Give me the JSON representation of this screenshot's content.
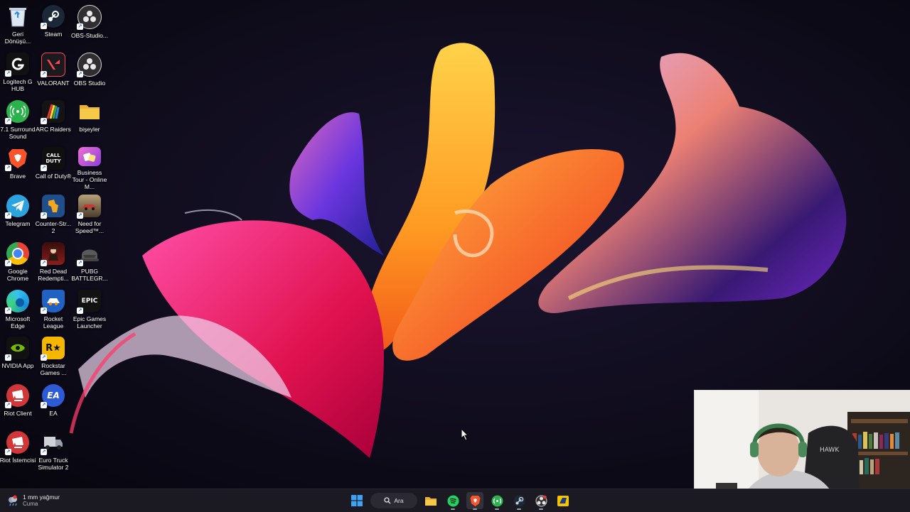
{
  "desktop": {
    "icons": [
      {
        "label": "Geri Dönüşü...",
        "icon": "recycle-bin-icon",
        "color": "#cfd8e3"
      },
      {
        "label": "Steam",
        "icon": "steam-icon",
        "color": "#1b2838"
      },
      {
        "label": "OBS-Studio...",
        "icon": "obs-icon",
        "color": "#302e31"
      },
      {
        "label": "Logitech G HUB",
        "icon": "logitech-icon",
        "color": "#111111"
      },
      {
        "label": "VALORANT",
        "icon": "valorant-icon",
        "color": "#1b1b1f"
      },
      {
        "label": "OBS Studio",
        "icon": "obs-icon",
        "color": "#302e31"
      },
      {
        "label": "7.1 Surround Sound",
        "icon": "surround-icon",
        "color": "#2bb24c"
      },
      {
        "label": "ARC Raiders",
        "icon": "arc-raiders-icon",
        "color": "#141414"
      },
      {
        "label": "bişeyler",
        "icon": "folder-icon",
        "color": "#f7c948"
      },
      {
        "label": "Brave",
        "icon": "brave-icon",
        "color": "#fb542b"
      },
      {
        "label": "Call of Duty®",
        "icon": "cod-icon",
        "color": "#0f0f0f"
      },
      {
        "label": "Business Tour - Online M...",
        "icon": "business-tour-icon",
        "color": "#d858c9"
      },
      {
        "label": "Telegram",
        "icon": "telegram-icon",
        "color": "#2aa3df"
      },
      {
        "label": "Counter-Str... 2",
        "icon": "counter-strike-icon",
        "color": "#1f4f8a"
      },
      {
        "label": "Need for Speed™...",
        "icon": "nfs-icon",
        "color": "#7a6c55"
      },
      {
        "label": "Google Chrome",
        "icon": "chrome-icon",
        "color": "#ffffff"
      },
      {
        "label": "Red Dead Redempti...",
        "icon": "rdr-icon",
        "color": "#8a1d1d"
      },
      {
        "label": "PUBG BATTLEGR...",
        "icon": "pubg-icon",
        "color": "#2d2d2d"
      },
      {
        "label": "Microsoft Edge",
        "icon": "edge-icon",
        "color": "#1a8dd8"
      },
      {
        "label": "Rocket League",
        "icon": "rocket-league-icon",
        "color": "#1f62c4"
      },
      {
        "label": "Epic Games Launcher",
        "icon": "epic-games-icon",
        "color": "#121212"
      },
      {
        "label": "NVIDIA App",
        "icon": "nvidia-icon",
        "color": "#111111"
      },
      {
        "label": "Rockstar Games ...",
        "icon": "rockstar-icon",
        "color": "#f5b600"
      },
      {
        "label": "Riot Client",
        "icon": "riot-client-icon",
        "color": "#d13639"
      },
      {
        "label": "EA",
        "icon": "ea-icon",
        "color": "#2d5bd6"
      },
      {
        "label": "Riot İstemcisi",
        "icon": "riot-client-icon",
        "color": "#d13639"
      },
      {
        "label": "Euro Truck Simulator 2",
        "icon": "ets2-icon",
        "color": "#3a3a3a"
      }
    ],
    "glyphs": {
      "cod": "CALL DUTY",
      "epic": "EPIC",
      "ea": "EA",
      "rockstar": "R★"
    }
  },
  "taskbar": {
    "weather_temp": "1 mm yağmur",
    "weather_day": "Cuma",
    "search_label": "Ara",
    "apps": [
      {
        "name": "start-button",
        "icon": "windows-icon"
      },
      {
        "name": "file-explorer-button",
        "icon": "folder-icon"
      },
      {
        "name": "spotify-button",
        "icon": "spotify-icon"
      },
      {
        "name": "brave-taskbar-button",
        "icon": "brave-icon"
      },
      {
        "name": "surround-taskbar-button",
        "icon": "surround-icon"
      },
      {
        "name": "steam-taskbar-button",
        "icon": "steam-icon"
      },
      {
        "name": "obs-taskbar-button",
        "icon": "obs-icon"
      },
      {
        "name": "ets-taskbar-button",
        "icon": "ets2-icon"
      }
    ]
  },
  "colors": {
    "taskbar_bg": "#1b1a22",
    "accent_blue": "#2b8ae6"
  }
}
